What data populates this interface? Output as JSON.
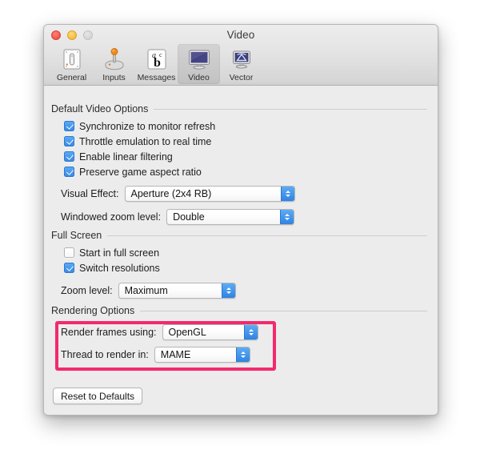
{
  "window": {
    "title": "Video",
    "traffic_lights": [
      {
        "name": "close",
        "color": "#f1554b",
        "state": "enabled"
      },
      {
        "name": "minimize",
        "color": "#f5bc3d",
        "state": "enabled"
      },
      {
        "name": "zoom",
        "color": "#d4d4d4",
        "state": "disabled"
      }
    ]
  },
  "toolbar": {
    "items": [
      {
        "label": "General",
        "icon": "general-icon",
        "selected": false
      },
      {
        "label": "Inputs",
        "icon": "joystick-icon",
        "selected": false
      },
      {
        "label": "Messages",
        "icon": "abc-icon",
        "selected": false
      },
      {
        "label": "Video",
        "icon": "monitor-icon",
        "selected": true
      },
      {
        "label": "Vector",
        "icon": "vector-icon",
        "selected": false
      }
    ]
  },
  "sections": {
    "default_video": {
      "title": "Default Video Options",
      "checkboxes": [
        {
          "label": "Synchronize to monitor refresh",
          "checked": true
        },
        {
          "label": "Throttle emulation to real time",
          "checked": true
        },
        {
          "label": "Enable linear filtering",
          "checked": true
        },
        {
          "label": "Preserve game aspect ratio",
          "checked": true
        }
      ],
      "popups": [
        {
          "label": "Visual Effect:",
          "value": "Aperture (2x4 RB)"
        },
        {
          "label": "Windowed zoom level:",
          "value": "Double"
        }
      ]
    },
    "full_screen": {
      "title": "Full Screen",
      "checkboxes": [
        {
          "label": "Start in full screen",
          "checked": false
        },
        {
          "label": "Switch resolutions",
          "checked": true
        }
      ],
      "popups": [
        {
          "label": "Zoom level:",
          "value": "Maximum"
        }
      ]
    },
    "rendering": {
      "title": "Rendering Options",
      "popups": [
        {
          "label": "Render frames using:",
          "value": "OpenGL"
        },
        {
          "label": "Thread to render in:",
          "value": "MAME"
        }
      ]
    }
  },
  "footer": {
    "reset_label": "Reset to Defaults"
  },
  "annotation": {
    "highlight_color": "#f4296d",
    "highlight_target": "rendering-options-popups"
  }
}
